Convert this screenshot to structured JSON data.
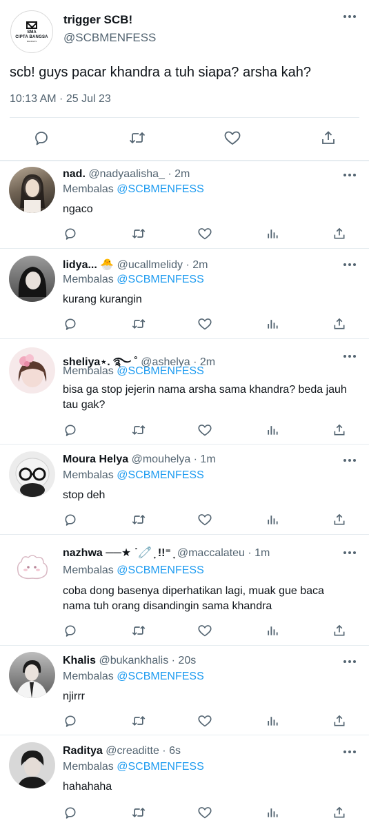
{
  "tweet": {
    "author_name": "trigger SCB!",
    "author_handle": "@SCBMENFESS",
    "avatar_lines": [
      "SMA",
      "CIPTA BANGSA",
      "MENFESS"
    ],
    "text": "scb! guys pacar khandra a tuh siapa? arsha kah?",
    "timestamp": "10:13 AM · 25 Jul 23",
    "actions": [
      "reply-icon",
      "retweet-icon",
      "like-icon",
      "share-icon"
    ]
  },
  "replying_label": "Membalas",
  "replying_mention": "@SCBMENFESS",
  "replies": [
    {
      "name": "nad.",
      "handle": "@nadyaalisha_ · 2m",
      "text": "ngaco",
      "avatar_color": "#8a7d6e"
    },
    {
      "name": "lidya... 🐣",
      "handle": "@ucallmelidy · 2m",
      "text": "kurang kurangin",
      "avatar_color": "#6b6b6b"
    },
    {
      "name": "sheliya⋆. ࿐ ˚",
      "handle": "@ashelya · 2m",
      "text": "bisa ga stop jejerin nama arsha sama khandra? beda jauh tau gak?",
      "avatar_color": "#f0d8dc"
    },
    {
      "name": "Moura Helya",
      "handle": "@mouhelya · 1m",
      "text": "stop deh",
      "avatar_color": "#dcdcdc"
    },
    {
      "name": "nazhwa ──★ ˙🧷 ̟ !!⁼ ̟",
      "handle": "@maccalateu · 1m",
      "text": "coba dong basenya diperhatikan lagi, muak gue baca nama tuh orang disandingin sama khandra",
      "avatar_color": "#ffffff"
    },
    {
      "name": "Khalis",
      "handle": "@bukankhalis · 20s",
      "text": "njirrr",
      "avatar_color": "#4a4a4a"
    },
    {
      "name": "Raditya",
      "handle": "@creaditte · 6s",
      "text": "hahahaha",
      "avatar_color": "#2b2b2b"
    }
  ],
  "colors": {
    "link": "#1d9bf0",
    "muted": "#536471",
    "text": "#0f1419",
    "divider": "#e6ecf0"
  }
}
